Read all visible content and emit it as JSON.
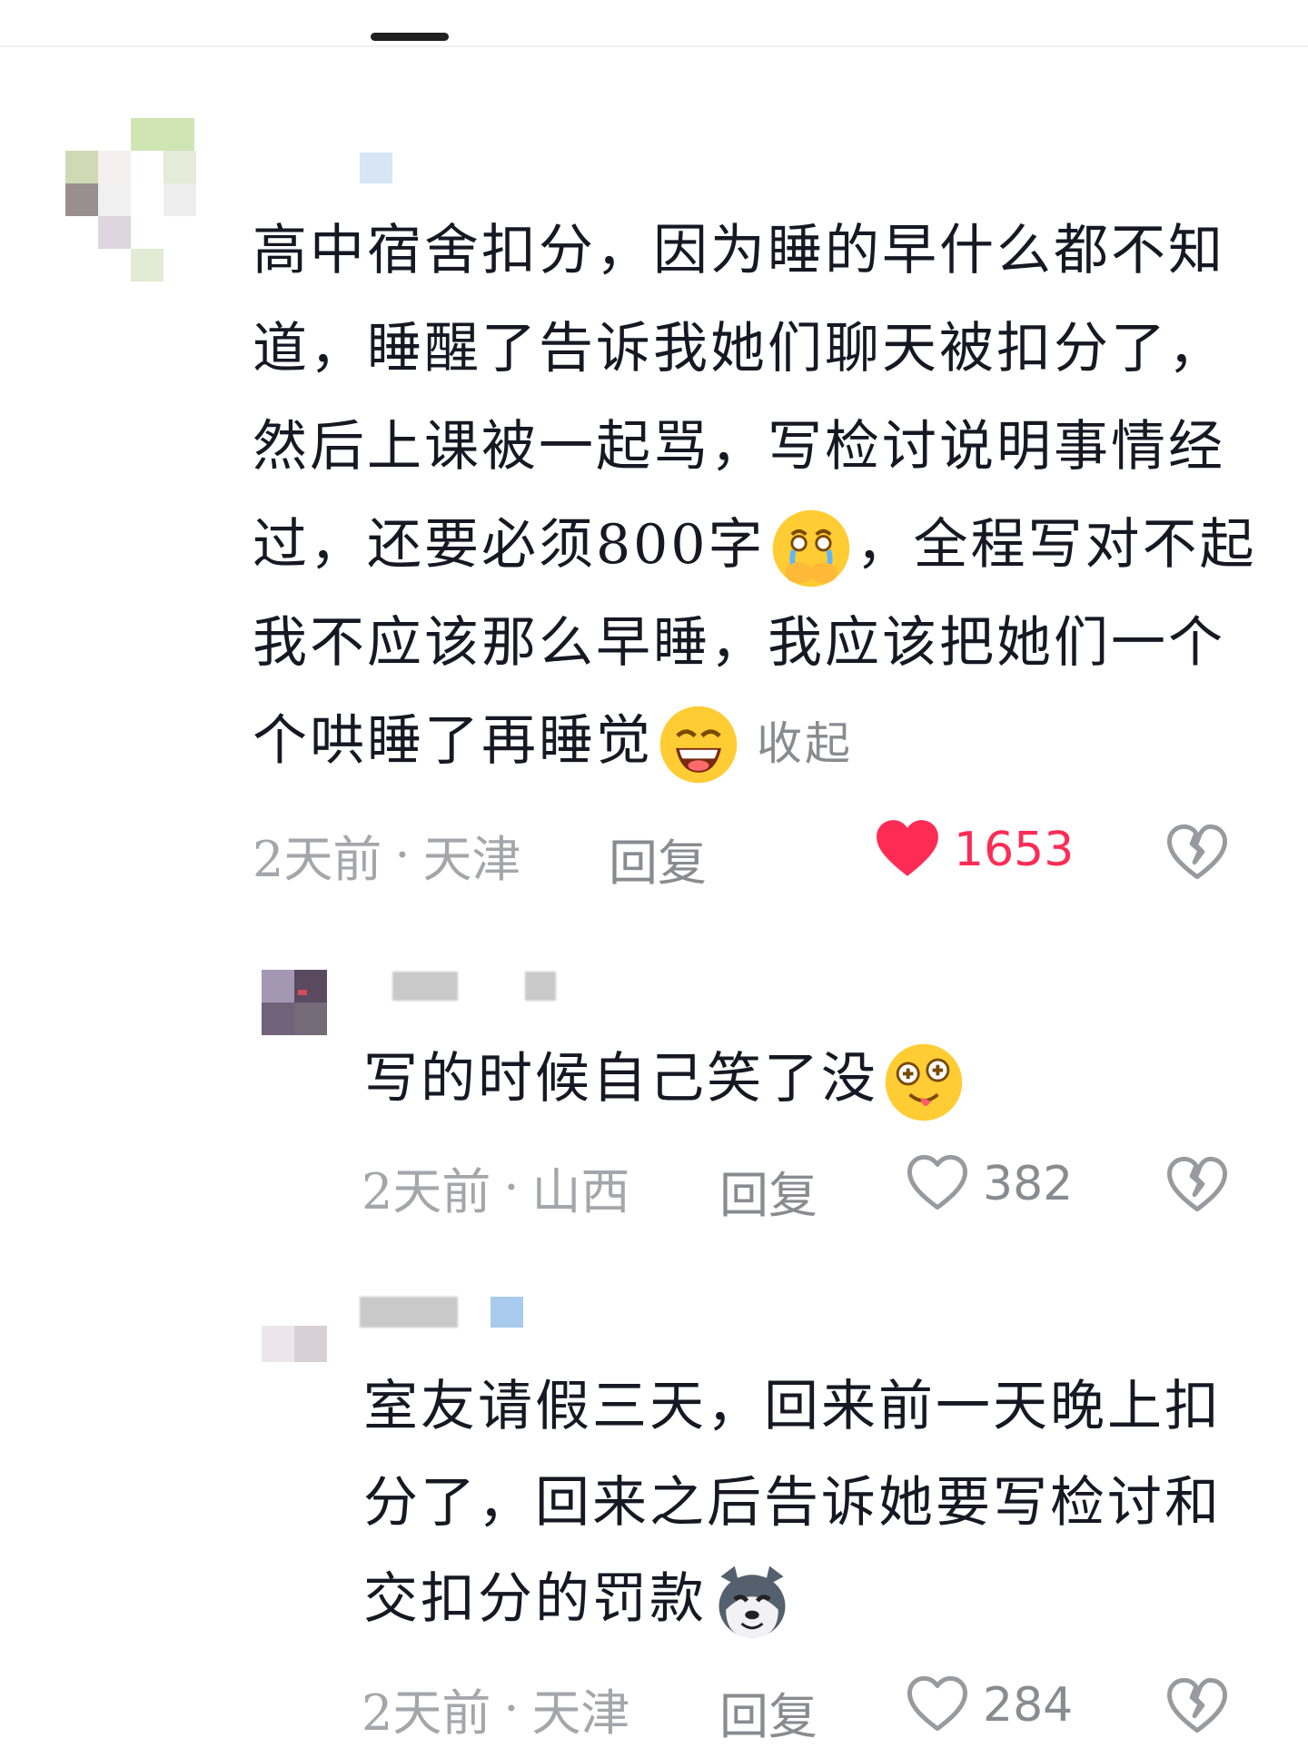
{
  "comments": [
    {
      "text_before_emoji_1": "高中宿舍扣分，因为睡的早什么都不知道，睡醒了告诉我她们聊天被扣分了，然后上课被一起骂，写检讨说明事情经过，还要必须800字",
      "emoji_1": "crying-face-emoji",
      "text_between": "，全程写对不起我不应该那么早睡，我应该把她们一个个哄睡了再睡觉",
      "emoji_2": "grinning-face-emoji",
      "collapse_label": "收起",
      "time": "2天前",
      "location": "天津",
      "reply_label": "回复",
      "likes": "1653",
      "liked": true
    },
    {
      "text": "写的时候自己笑了没",
      "emoji": "goofy-face-emoji",
      "time": "2天前",
      "location": "山西",
      "reply_label": "回复",
      "likes": "382",
      "liked": false
    },
    {
      "text": "室友请假三天，回来前一天晚上扣分了，回来之后告诉她要写检讨和交扣分的罚款",
      "emoji": "husky-dog-emoji",
      "time": "2天前",
      "location": "天津",
      "reply_label": "回复",
      "likes": "284",
      "liked": false
    }
  ],
  "meta_separator": "·",
  "colors": {
    "like_red": "#fe2c55",
    "meta_gray": "#a5a6ab",
    "text": "#161823"
  }
}
